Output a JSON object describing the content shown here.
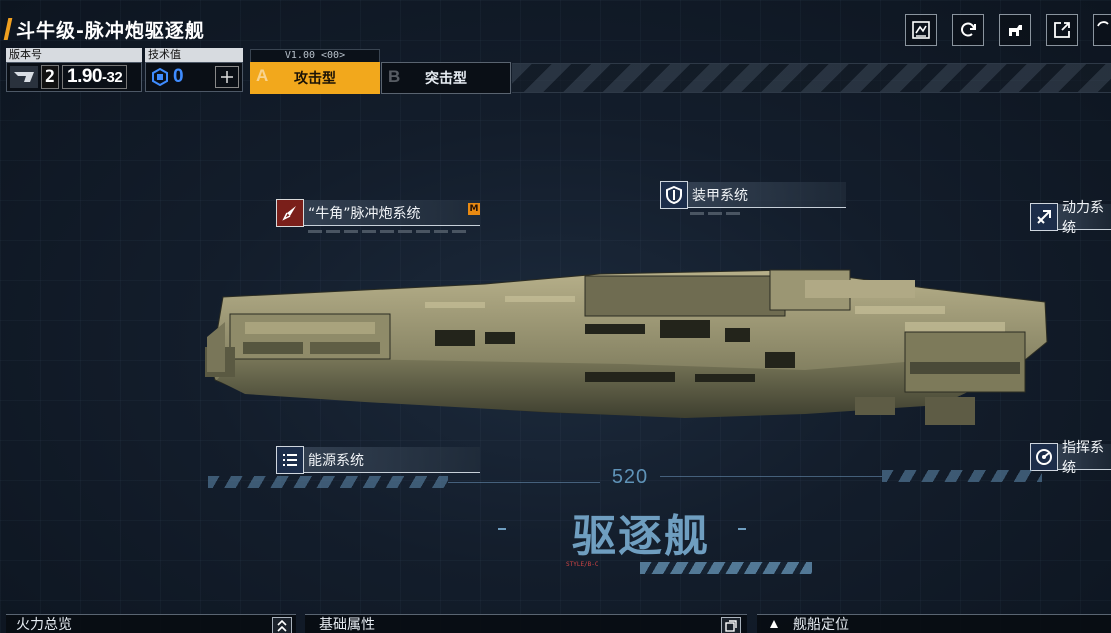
{
  "title": "斗牛级-脉冲炮驱逐舰",
  "version": {
    "label": "版本号",
    "number": "2",
    "value_main": "1.90",
    "value_sub": "-32"
  },
  "tech": {
    "label": "技术值",
    "value": "0"
  },
  "variant_tag": "V1.00 <00>",
  "tabs": [
    {
      "letter": "A",
      "label": "攻击型",
      "active": true
    },
    {
      "letter": "B",
      "label": "突击型",
      "active": false
    }
  ],
  "top_icons": [
    "blueprint-icon",
    "refresh-icon",
    "share-dog-icon",
    "export-icon",
    "fullscreen-icon"
  ],
  "systems": {
    "weapon": "“牛角”脉冲炮系统",
    "armor": "装甲系统",
    "power": "动力系统",
    "energy": "能源系统",
    "command": "指挥系统"
  },
  "weapon_badge": "M",
  "ship_class": {
    "number": "520",
    "name": "驱逐舰",
    "sub": "STYLE/B-C"
  },
  "bottom": {
    "firepower": "火力总览",
    "attributes": "基础属性",
    "positioning": "舰船定位"
  },
  "colors": {
    "accent": "#f2a81c",
    "tech_blue": "#3f8cff",
    "hud_blue": "#6f9ec0"
  }
}
